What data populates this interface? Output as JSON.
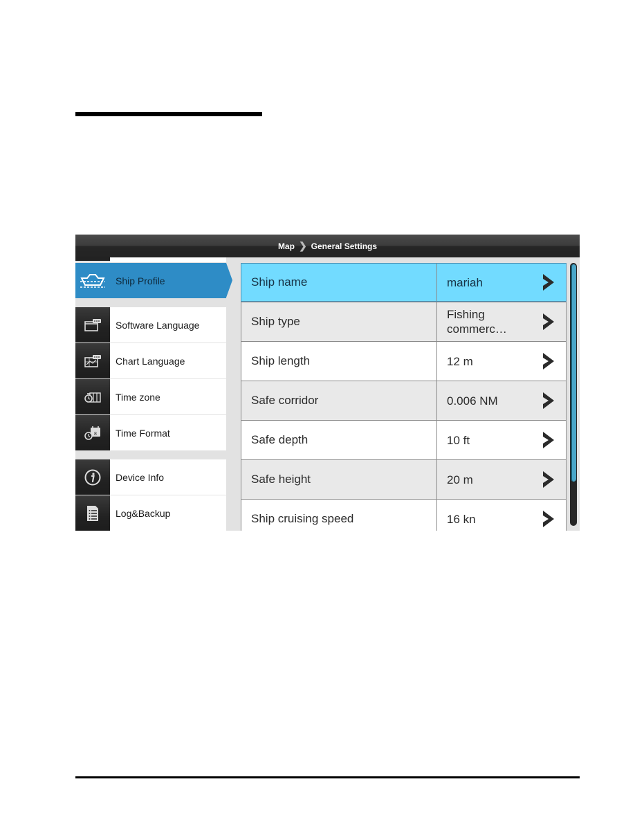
{
  "header": {
    "breadcrumb": [
      "Map",
      "General Settings"
    ]
  },
  "sidebar": {
    "items": [
      {
        "label": "Ship Profile",
        "icon": "ship-icon",
        "active": true
      },
      {
        "label": "Software Language",
        "icon": "language-window-icon"
      },
      {
        "label": "Chart Language",
        "icon": "chart-language-icon"
      },
      {
        "label": "Time zone",
        "icon": "time-zone-icon"
      },
      {
        "label": "Time Format",
        "icon": "time-format-icon"
      },
      {
        "label": "Device Info",
        "icon": "info-icon"
      },
      {
        "label": "Log&Backup",
        "icon": "log-document-icon"
      }
    ]
  },
  "settings": {
    "rows": [
      {
        "name": "Ship name",
        "value": "mariah",
        "highlighted": true
      },
      {
        "name": "Ship type",
        "value": "Fishing commerc…"
      },
      {
        "name": "Ship length",
        "value": "12 m"
      },
      {
        "name": "Safe corridor",
        "value": "0.006 NM"
      },
      {
        "name": "Safe depth",
        "value": "10 ft"
      },
      {
        "name": "Safe height",
        "value": "20 m"
      },
      {
        "name": "Ship cruising speed",
        "value": "16 kn"
      }
    ],
    "scroll_position_fraction": 0.83
  },
  "colors": {
    "accent": "#2e8cc6",
    "highlight_row": "#72dbff",
    "titlebar": "#2a2a2a"
  }
}
